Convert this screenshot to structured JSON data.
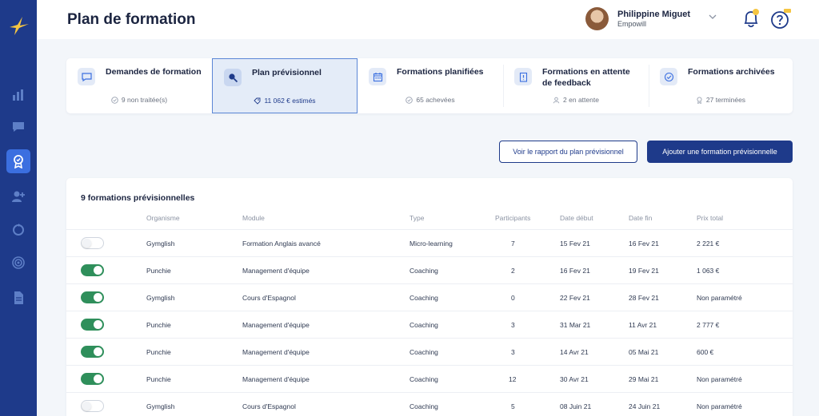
{
  "header": {
    "title": "Plan de formation",
    "user_name": "Philippine Miguet",
    "user_org": "Empowill"
  },
  "sidebar": {
    "icons": [
      "logo-bird",
      "bar-chart",
      "chat-bubble",
      "award-badge",
      "user-add",
      "globe-refresh",
      "target",
      "document"
    ],
    "active": "award-badge"
  },
  "tabs": [
    {
      "label": "Demandes de formation",
      "status": "9 non traitée(s)",
      "icon": "chat-bubble"
    },
    {
      "label": "Plan prévisionnel",
      "status": "11 062 € estimés",
      "icon": "search"
    },
    {
      "label": "Formations planifiées",
      "status": "65 achevées",
      "icon": "calendar"
    },
    {
      "label": "Formations en attente de feedback",
      "status": "2 en attente",
      "icon": "clipboard"
    },
    {
      "label": "Formations archivées",
      "status": "27 terminées",
      "icon": "check-circle"
    }
  ],
  "actions": {
    "report_label": "Voir le rapport du plan prévisionnel",
    "add_label": "Ajouter une formation prévisionnelle"
  },
  "table": {
    "title": "9 formations prévisionnelles",
    "columns": [
      "Organisme",
      "Module",
      "Type",
      "Participants",
      "Date début",
      "Date fin",
      "Prix total"
    ],
    "rows": [
      {
        "enabled": false,
        "organisme": "Gymglish",
        "module": "Formation Anglais avancé",
        "type": "Micro-learning",
        "participants": "7",
        "debut": "15 Fev 21",
        "fin": "16 Fev 21",
        "prix": "2 221  €"
      },
      {
        "enabled": true,
        "organisme": "Punchie",
        "module": "Management d'équipe",
        "type": "Coaching",
        "participants": "2",
        "debut": "16 Fev 21",
        "fin": "19 Fev 21",
        "prix": "1 063  €"
      },
      {
        "enabled": true,
        "organisme": "Gymglish",
        "module": "Cours d'Espagnol",
        "type": "Coaching",
        "participants": "0",
        "debut": "22 Fev 21",
        "fin": "28 Fev 21",
        "prix": "Non paramétré"
      },
      {
        "enabled": true,
        "organisme": "Punchie",
        "module": "Management d'équipe",
        "type": "Coaching",
        "participants": "3",
        "debut": "31 Mar 21",
        "fin": "11 Avr 21",
        "prix": "2 777  €"
      },
      {
        "enabled": true,
        "organisme": "Punchie",
        "module": "Management d'équipe",
        "type": "Coaching",
        "participants": "3",
        "debut": "14 Avr 21",
        "fin": "05 Mai 21",
        "prix": "600  €"
      },
      {
        "enabled": true,
        "organisme": "Punchie",
        "module": "Management d'équipe",
        "type": "Coaching",
        "participants": "12",
        "debut": "30 Avr 21",
        "fin": "29 Mai 21",
        "prix": "Non paramétré"
      },
      {
        "enabled": false,
        "organisme": "Gymglish",
        "module": "Cours d'Espagnol",
        "type": "Coaching",
        "participants": "5",
        "debut": "08 Juin 21",
        "fin": "24 Juin 21",
        "prix": "Non paramétré"
      }
    ]
  },
  "colors": {
    "sidebar": "#1e3a8a",
    "accent": "#3b6fe0",
    "toggle_on": "#2f8f5b",
    "badge": "#f5c542"
  }
}
